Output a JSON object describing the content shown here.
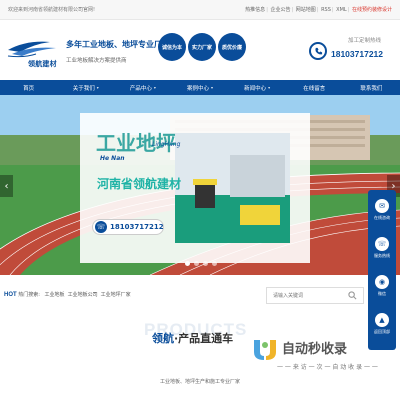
{
  "topbar": {
    "welcome": "欢迎来到河南省领航建材有限公司官网!",
    "links": [
      "热推信息",
      "企业公告",
      "网站地图",
      "RSS",
      "XML"
    ],
    "highlight": "在线预约装修设计"
  },
  "header": {
    "logo_text": "领航建材",
    "slogan_title": "多年工业地板、地坪专业厂家",
    "slogan_sub": "工业地板解决方案提供商",
    "badges": [
      "诚信为本",
      "实力厂家",
      "质优价廉"
    ],
    "phone_label": "加工定制热线",
    "phone_number": "18103717212"
  },
  "nav": {
    "items": [
      {
        "label": "首页",
        "caret": false
      },
      {
        "label": "关于我们",
        "caret": true
      },
      {
        "label": "产品中心",
        "caret": true
      },
      {
        "label": "案例中心",
        "caret": true
      },
      {
        "label": "新闻中心",
        "caret": true
      },
      {
        "label": "在线留言",
        "caret": false
      },
      {
        "label": "联系我们",
        "caret": false
      }
    ]
  },
  "banner": {
    "title_main": "工业地坪",
    "title_pinyin_left": "He Nan",
    "title_pinyin_right": "LingHang",
    "company": "河南省领航建材",
    "phone": "18103717212",
    "prev_arrow": "‹",
    "next_arrow": "›",
    "slides_count": 4,
    "active_slide": 1
  },
  "float_sidebar": {
    "items": [
      {
        "label": "在线咨询",
        "icon": "chat-icon",
        "glyph": "✉"
      },
      {
        "label": "服务热线",
        "icon": "phone-icon",
        "glyph": "☏"
      },
      {
        "label": "微信",
        "icon": "wechat-icon",
        "glyph": "◉"
      },
      {
        "label": "返回顶部",
        "icon": "up-icon",
        "glyph": "▲"
      }
    ]
  },
  "hot": {
    "prefix": "HOT",
    "label": "热门搜索:",
    "keywords": [
      "工业地板",
      "工业地板公司",
      "工业地坪厂家"
    ]
  },
  "search": {
    "placeholder": "请输入关键词"
  },
  "products": {
    "ghost_text": "PRODUCTS",
    "heading_blue": "领航",
    "heading_dark": "·产品直通车",
    "subtitle": "工业地板、地坪生产和施工专业厂家"
  },
  "watermark": {
    "text": "自动秒收录",
    "sub": "一 一 来 访 一 次 一 自 动 收 录 一 一"
  },
  "colors": {
    "brand": "#0a4d9a",
    "track": "#c04b3a",
    "floor_green": "#1a9d7c",
    "floor_yellow": "#f0d43a"
  }
}
